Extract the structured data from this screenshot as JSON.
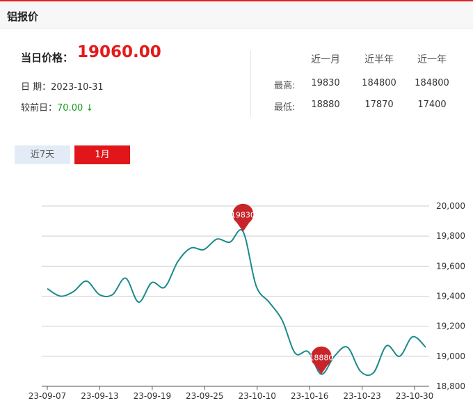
{
  "header": {
    "title": "铝报价"
  },
  "summary": {
    "price_label": "当日价格：",
    "price_value": "19060.00",
    "date_label": "日  期：",
    "date_value": "2023-10-31",
    "change_label": "较前日：",
    "change_value": "70.00",
    "change_arrow": "↓"
  },
  "stats": {
    "columns": [
      "近一月",
      "近半年",
      "近一年"
    ],
    "rows": [
      {
        "label": "最高:",
        "values": [
          "19830",
          "184800",
          "184800"
        ]
      },
      {
        "label": "最低:",
        "values": [
          "18880",
          "17870",
          "17400"
        ]
      }
    ]
  },
  "tabs": [
    {
      "label": "近7天",
      "active": false
    },
    {
      "label": "1月",
      "active": true
    }
  ],
  "colors": {
    "accent": "#e0161a",
    "line": "#1a8a8a",
    "marker": "#c8252a",
    "down": "#1a9a1a"
  },
  "chart_data": {
    "type": "line",
    "x_ticks": [
      "23-09-07",
      "23-09-13",
      "23-09-19",
      "23-09-25",
      "23-10-10",
      "23-10-16",
      "23-10-23",
      "23-10-30"
    ],
    "y_ticks": [
      "20,000",
      "19,800",
      "19,600",
      "19,400",
      "19,200",
      "19,000",
      "18,800"
    ],
    "ylim": [
      18800,
      20000
    ],
    "grid": true,
    "series": [
      {
        "values": [
          19450,
          19400,
          19430,
          19500,
          19410,
          19410,
          19520,
          19360,
          19490,
          19460,
          19630,
          19720,
          19710,
          19780,
          19760,
          19830,
          19470,
          19360,
          19240,
          19020,
          19030,
          18880,
          19000,
          19060,
          18900,
          18890,
          19070,
          19000,
          19130,
          19060
        ]
      }
    ],
    "markers": [
      {
        "label": "19830",
        "index": 15,
        "value": 19830
      },
      {
        "label": "18880",
        "index": 21,
        "value": 18880
      }
    ]
  }
}
